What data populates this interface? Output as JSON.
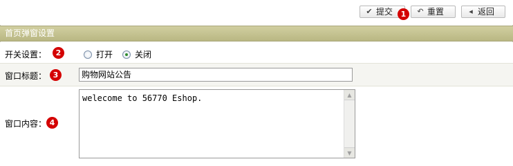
{
  "toolbar": {
    "submit_label": "提交",
    "reset_label": "重置",
    "back_label": "返回"
  },
  "badges": [
    "1",
    "2",
    "3",
    "4"
  ],
  "section": {
    "title": "首页弹窗设置"
  },
  "form": {
    "switch_label": "开关设置：",
    "options": [
      {
        "label": "打开",
        "checked": false
      },
      {
        "label": "关闭",
        "checked": true
      }
    ],
    "title_label": "窗口标题：",
    "title_value": "购物网站公告",
    "content_label": "窗口内容：",
    "content_value": "welecome to 56770 Eshop."
  },
  "colors": {
    "header_bg": "#c4c290",
    "badge": "#d40000"
  }
}
